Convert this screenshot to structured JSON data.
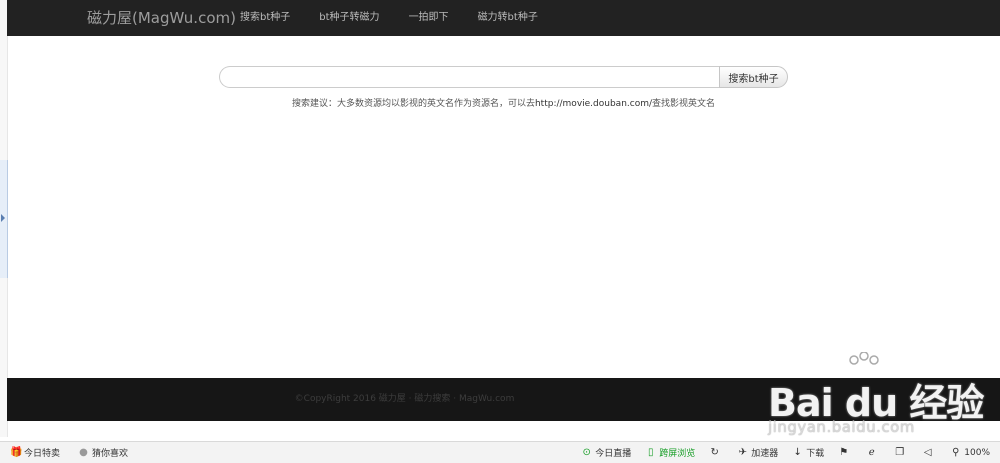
{
  "navbar": {
    "brand": "磁力屋(MagWu.com)",
    "links": [
      "搜索bt种子",
      "bt种子转磁力",
      "一拍即下",
      "磁力转bt种子"
    ]
  },
  "search": {
    "value": "",
    "placeholder": "",
    "button_label": "搜索bt种子",
    "tip_prefix": "搜索建议：大多数资源均以影视的英文名作为资源名，可以去",
    "tip_link": "http://movie.douban.com/",
    "tip_suffix": "查找影视英文名"
  },
  "footer": {
    "text": "©CopyRight 2016 磁力屋 · 磁力搜索 · MagWu.com"
  },
  "watermark": {
    "logo": "Bai du 经验",
    "sub": "jingyan.baidu.com"
  },
  "statusbar": {
    "left": [
      {
        "icon": "gift-icon",
        "label": "今日特卖"
      },
      {
        "icon": "dot-icon",
        "label": "猜你喜欢"
      }
    ],
    "right": [
      {
        "icon": "play-icon",
        "label": "今日直播"
      },
      {
        "icon": "phone-icon",
        "label": "跨屏浏览"
      },
      {
        "icon": "refresh-icon",
        "label": ""
      },
      {
        "icon": "rocket-icon",
        "label": "加速器"
      },
      {
        "icon": "download-icon",
        "label": "下载"
      },
      {
        "icon": "flag-icon",
        "label": ""
      },
      {
        "icon": "ie-icon",
        "label": ""
      },
      {
        "icon": "window-icon",
        "label": ""
      },
      {
        "icon": "speaker-icon",
        "label": ""
      },
      {
        "icon": "zoom-icon",
        "label": "100%"
      }
    ]
  },
  "colors": {
    "navbar": "#222222",
    "footer": "#161616",
    "statusbar_green": "#1a9f29"
  }
}
